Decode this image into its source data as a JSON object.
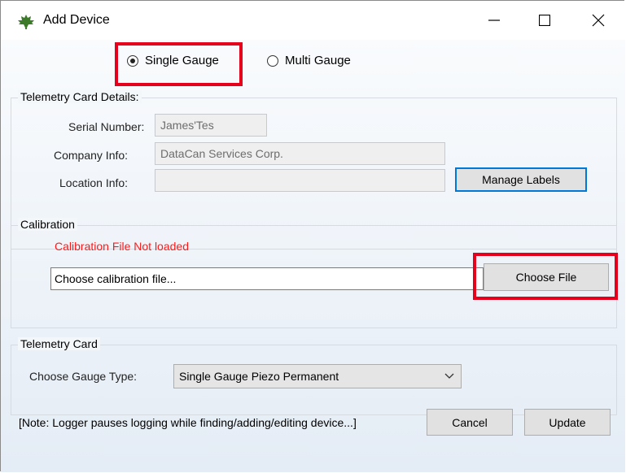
{
  "window": {
    "title": "Add Device",
    "controls": {
      "minimize": "minimize",
      "maximize": "maximize",
      "close": "close"
    }
  },
  "mode": {
    "single_label": "Single Gauge",
    "multi_label": "Multi Gauge",
    "selected": "Single Gauge"
  },
  "telemetry_details": {
    "legend": "Telemetry Card Details:",
    "serial_label": "Serial Number:",
    "serial_value": "James'Tes",
    "company_label": "Company Info:",
    "company_value": "DataCan Services Corp.",
    "location_label": "Location Info:",
    "location_value": "",
    "manage_labels_button": "Manage Labels"
  },
  "calibration": {
    "legend": "Calibration",
    "status": "Calibration File Not loaded",
    "file_placeholder": "Choose calibration file...",
    "choose_file_button": "Choose File"
  },
  "telemetry_card": {
    "legend": "Telemetry Card",
    "gauge_type_label": "Choose Gauge Type:",
    "gauge_type_value": "Single Gauge Piezo Permanent"
  },
  "footer": {
    "note": "[Note: Logger pauses logging while finding/adding/editing device...]",
    "cancel_button": "Cancel",
    "update_button": "Update"
  },
  "colors": {
    "highlight": "#e6001c",
    "error": "#ff1a1a",
    "focus_border": "#0078d7"
  },
  "icons": {
    "app": "maple-leaf-icon",
    "dropdown": "chevron-down-icon"
  }
}
